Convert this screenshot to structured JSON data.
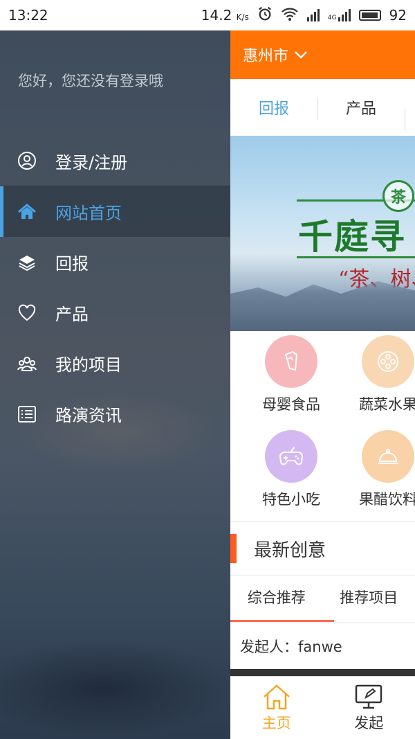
{
  "status_bar": {
    "time": "13:22",
    "speed": "14.2",
    "speed_unit": "K/s",
    "network": "4G",
    "battery": "92"
  },
  "drawer": {
    "greeting": "您好，您还没有登录哦",
    "items": [
      {
        "label": "登录/注册",
        "icon": "user-circle-icon"
      },
      {
        "label": "网站首页",
        "icon": "home-icon"
      },
      {
        "label": "回报",
        "icon": "layers-icon"
      },
      {
        "label": "产品",
        "icon": "heart-icon"
      },
      {
        "label": "我的项目",
        "icon": "group-icon"
      },
      {
        "label": "路演资讯",
        "icon": "list-icon"
      }
    ],
    "active_index": 1,
    "accent": "#4ba3e3"
  },
  "main": {
    "city": "惠州市",
    "tabs": [
      {
        "label": "回报"
      },
      {
        "label": "产品"
      }
    ],
    "banner": {
      "seal": "茶",
      "title": "千庭寻",
      "subtitle": "“茶、树、"
    },
    "categories": [
      {
        "label": "母婴食品",
        "color": "#f7b8bc",
        "icon": "bottle-icon"
      },
      {
        "label": "蔬菜水果",
        "color": "#f9d7b3",
        "icon": "film-reel-icon"
      },
      {
        "label": "特色小吃",
        "color": "#d4b8f2",
        "icon": "gamepad-icon"
      },
      {
        "label": "果醋饮料",
        "color": "#f9d2a8",
        "icon": "cloche-icon"
      }
    ],
    "section_title": "最新创意",
    "subtabs": [
      {
        "label": "综合推荐"
      },
      {
        "label": "推荐项目"
      }
    ],
    "initiator": "发起人：fanwe",
    "bottom_nav": [
      {
        "label": "主页",
        "icon": "home-outline-icon"
      },
      {
        "label": "发起",
        "icon": "monitor-edit-icon"
      }
    ],
    "brand_color": "#ff7307"
  }
}
